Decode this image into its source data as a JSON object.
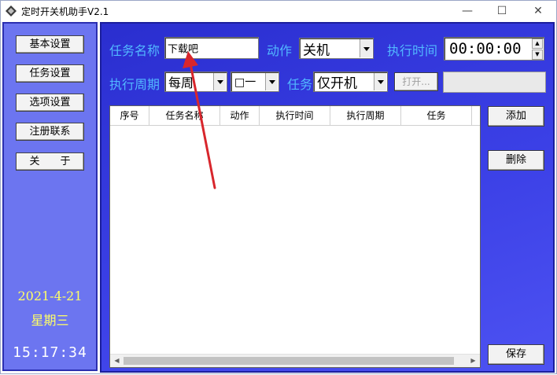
{
  "window": {
    "title": "定时开关机助手V2.1",
    "controls": {
      "minimize": "—",
      "maximize": "☐",
      "close": "✕"
    }
  },
  "sidebar": {
    "buttons": [
      {
        "label": "基本设置"
      },
      {
        "label": "任务设置"
      },
      {
        "label": "选项设置"
      },
      {
        "label": "注册联系"
      },
      {
        "label": "关　　于"
      }
    ],
    "date": "2021-4-21",
    "weekday": "星期三",
    "clock": "15:17:34"
  },
  "form": {
    "task_name_label": "任务名称",
    "task_name_value": "下载吧",
    "action_label": "动作",
    "action_value": "关机",
    "exec_time_label": "执行时间",
    "exec_time_value": "00:00:00",
    "period_label": "执行周期",
    "period_value": "每周",
    "day_value": "□一",
    "task_label": "任务",
    "task_value": "仅开机",
    "open_button": "打开...",
    "path_value": ""
  },
  "table": {
    "columns": [
      "序号",
      "任务名称",
      "动作",
      "执行时间",
      "执行周期",
      "任务"
    ],
    "rows": []
  },
  "actions": {
    "add": "添加",
    "delete": "删除",
    "save": "保存"
  },
  "colors": {
    "sidebar_bg": "#6c75f0",
    "main_bg": "#3b40e6",
    "label": "#52b8ff",
    "date": "#ffff66",
    "clock": "#ffffff",
    "arrow": "#d8262c"
  }
}
